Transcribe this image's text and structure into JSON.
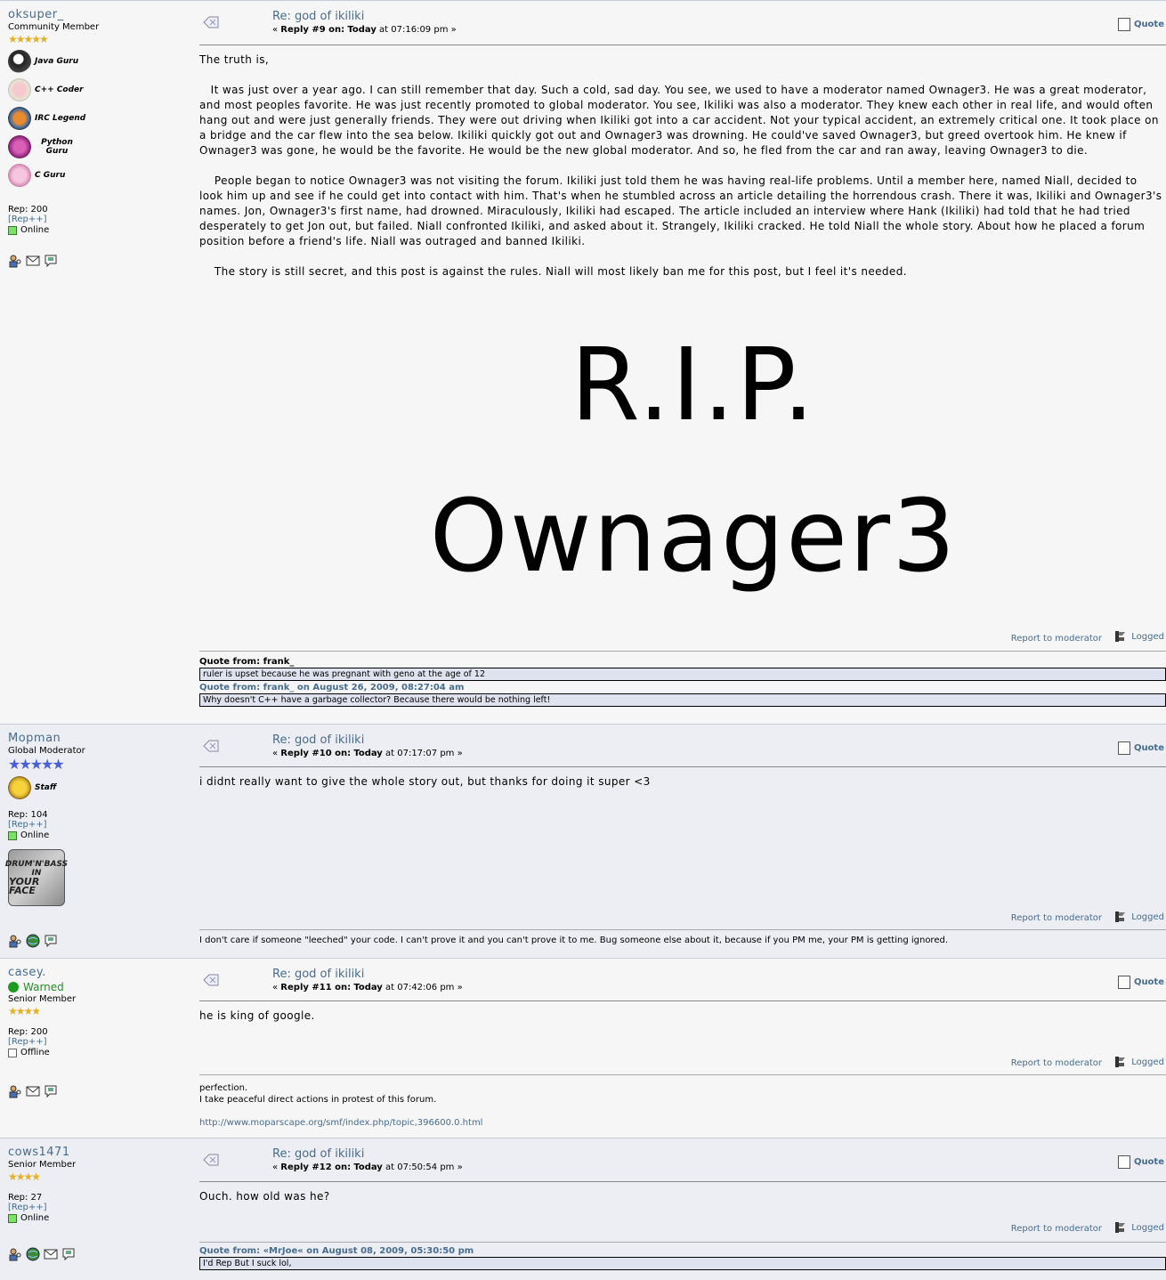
{
  "posts": [
    {
      "username": "oksuper_",
      "title": "Community Member",
      "stars": "★★★★★",
      "badges": [
        "Java Guru",
        "C++ Coder",
        "IRC Legend",
        "Python Guru",
        "C Guru"
      ],
      "rep": "Rep: 200",
      "rep_link": "[Rep++]",
      "status": "Online",
      "subject": "Re: god of ikiliki",
      "reply_label": "Reply #9 on:",
      "reply_day": "Today",
      "reply_time": "at 07:16:09 pm »",
      "quote_label": "Quote",
      "body": [
        "The truth is,",
        "   It was just over a year ago. I can still remember that day. Such a cold, sad day. You see, we used to have a moderator named Ownager3. He was a great moderator, and most peoples favorite. He was just recently promoted to global moderator. You see, Ikiliki was also a moderator. They knew each other in real life, and would often hang out and were just generally friends. They were out driving when Ikiliki got into a car accident. Not your typical accident, an extremely critical one. It took place on a bridge and the car flew into the sea below. Ikiliki quickly got out and Ownager3 was drowning. He could've saved Ownager3, but greed overtook him. He knew if Ownager3 was gone, he would be the favorite. He would be the new global moderator. And so, he fled from the car and ran away, leaving Ownager3 to die.",
        "    People began to notice Ownager3 was not visiting the forum. Ikiliki just told them he was having real-life problems. Until a member here, named Niall, decided to look him up and see if he could get into contact with him. That's when he stumbled across an article detailing the horrendous crash. There it was, Ikiliki and Ownager3's names. Jon, Ownager3's first name, had drowned. Miraculously, Ikiliki had escaped. The article included an interview where Hank (Ikiliki) had told that he had tried desperately to get Jon out, but failed. Niall confronted Ikiliki, and asked about it. Strangely, Ikiliki cracked. He told Niall the whole story. About how he placed a forum position before a friend's life. Niall was outraged and banned Ikiliki.",
        "    The story is still secret, and this post is against the rules. Niall will most likely ban me for this post, but I feel it's needed."
      ],
      "big_text_1": "R.I.P.",
      "big_text_2": "Ownager3",
      "report": "Report to moderator",
      "logged": "Logged",
      "sig_quote1_head": "Quote from: frank_",
      "sig_quote1_body": "ruler is upset because he was pregnant with geno at the age of 12",
      "sig_quote2_head": "Quote from: frank_ on August 26, 2009, 08:27:04 am",
      "sig_quote2_body": "Why doesn't C++ have a garbage collector? Because there would be nothing left!"
    },
    {
      "username": "Mopman",
      "title": "Global Moderator",
      "stars": "★★★★★",
      "badges": [
        "Staff"
      ],
      "rep": "Rep: 104",
      "rep_link": "[Rep++]",
      "status": "Online",
      "avatar_text": [
        "DRUM'N'BASS",
        "IN",
        "YOUR FACE"
      ],
      "subject": "Re: god of ikiliki",
      "reply_label": "Reply #10 on:",
      "reply_day": "Today",
      "reply_time": "at 07:17:07 pm »",
      "quote_label": "Quote",
      "body": [
        "i didnt really want to give the whole story out, but thanks for doing it super <3"
      ],
      "report": "Report to moderator",
      "logged": "Logged",
      "signature": "I don't care if someone \"leeched\" your code. I can't prove it and you can't prove it to me. Bug someone else about it, because if you PM me, your PM is getting ignored."
    },
    {
      "username": "casey.",
      "warned": "Warned",
      "title": "Senior Member",
      "stars": "★★★★",
      "rep": "Rep: 200",
      "rep_link": "[Rep++]",
      "status": "Offline",
      "subject": "Re: god of ikiliki",
      "reply_label": "Reply #11 on:",
      "reply_day": "Today",
      "reply_time": "at 07:42:06 pm »",
      "quote_label": "Quote",
      "body": [
        "he is king of google."
      ],
      "report": "Report to moderator",
      "logged": "Logged",
      "sig_line1": "perfection.",
      "sig_line2": "I take peaceful direct actions in protest of this forum.",
      "sig_url": "http://www.moparscape.org/smf/index.php/topic,396600.0.html"
    },
    {
      "username": "cows1471",
      "title": "Senior Member",
      "stars": "★★★★",
      "rep": "Rep: 27",
      "rep_link": "[Rep++]",
      "status": "Online",
      "subject": "Re: god of ikiliki",
      "reply_label": "Reply #12 on:",
      "reply_day": "Today",
      "reply_time": "at 07:50:54 pm »",
      "quote_label": "Quote",
      "body": [
        "Ouch. how old was he?"
      ],
      "report": "Report to moderator",
      "logged": "Logged",
      "sig_quote_head": "Quote from: «MrJoe« on August 08, 2009, 05:30:50 pm",
      "sig_quote_body": "I'd Rep But I suck lol,"
    }
  ],
  "colors": {
    "link": "#476c8e",
    "post_light": "#f6f6f6",
    "post_dark": "#eceef3",
    "quote_bg": "#dfe2ef"
  },
  "icons": [
    "profile-icon",
    "email-icon",
    "pm-icon",
    "website-icon",
    "xx-message-icon",
    "quote-icon",
    "logged-icon"
  ]
}
